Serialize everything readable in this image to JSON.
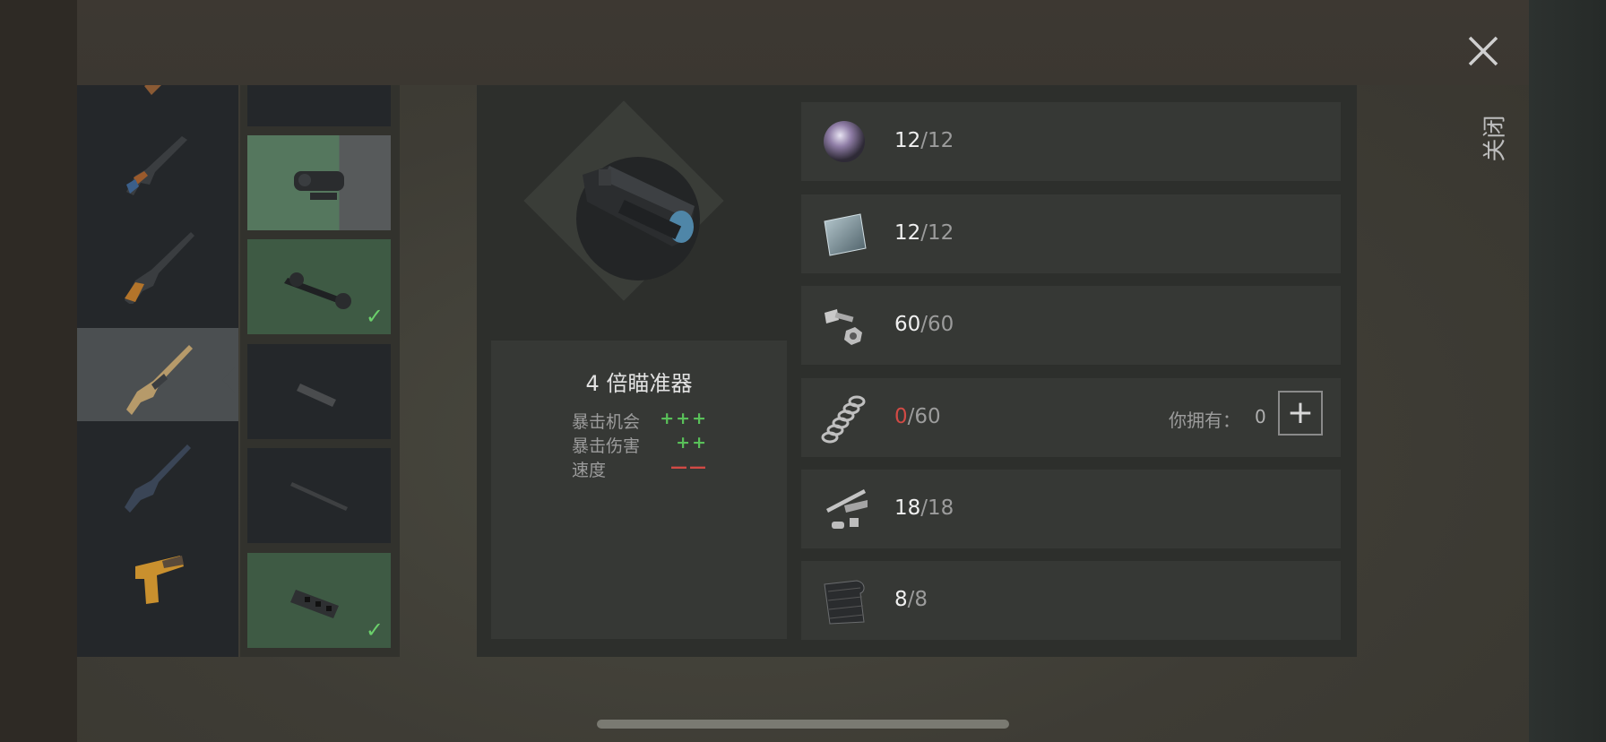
{
  "close": {
    "label": "关闭",
    "icon": "close-icon"
  },
  "weapons": [
    {
      "name": "weapon-partial-top",
      "color": "#8a5a34"
    },
    {
      "name": "ak-rifle",
      "color": "#9a5a2c"
    },
    {
      "name": "sniper-rifle",
      "color": "#b3742a"
    },
    {
      "name": "tan-assault-rifle",
      "color": "#b69a6a",
      "selected": true
    },
    {
      "name": "m16-rifle",
      "color": "#3a4556"
    },
    {
      "name": "flare-pistol",
      "color": "#c9902e"
    }
  ],
  "attachments": [
    {
      "icon": "scope-icon",
      "state": "normal"
    },
    {
      "icon": "red-dot-scope-icon",
      "state": "selected"
    },
    {
      "icon": "long-scope-icon",
      "state": "installed"
    },
    {
      "icon": "suppressor-short-icon",
      "state": "normal"
    },
    {
      "icon": "barrel-icon",
      "state": "normal"
    },
    {
      "icon": "muzzle-brake-icon",
      "state": "installed"
    }
  ],
  "item": {
    "title": "4 倍瞄准器",
    "stats": [
      {
        "label": "暴击机会",
        "value": "+++",
        "kind": "plus"
      },
      {
        "label": "暴击伤害",
        "value": "++",
        "kind": "plus"
      },
      {
        "label": "速度",
        "value": "——",
        "kind": "minus"
      }
    ]
  },
  "materials": [
    {
      "icon": "lens-icon",
      "have": "12",
      "sep": "/",
      "need": "12",
      "lack": false
    },
    {
      "icon": "glass-plate-icon",
      "have": "12",
      "sep": "/",
      "need": "12",
      "lack": false
    },
    {
      "icon": "bolt-nut-icon",
      "have": "60",
      "sep": "/",
      "need": "60",
      "lack": false
    },
    {
      "icon": "spring-icon",
      "have": "0",
      "sep": "/",
      "need": "60",
      "lack": true,
      "own_label": "你拥有：",
      "own_value": "0",
      "add": "+"
    },
    {
      "icon": "metal-parts-icon",
      "have": "18",
      "sep": "/",
      "need": "18",
      "lack": false
    },
    {
      "icon": "carbon-sheet-icon",
      "have": "8",
      "sep": "/",
      "need": "8",
      "lack": false
    }
  ]
}
